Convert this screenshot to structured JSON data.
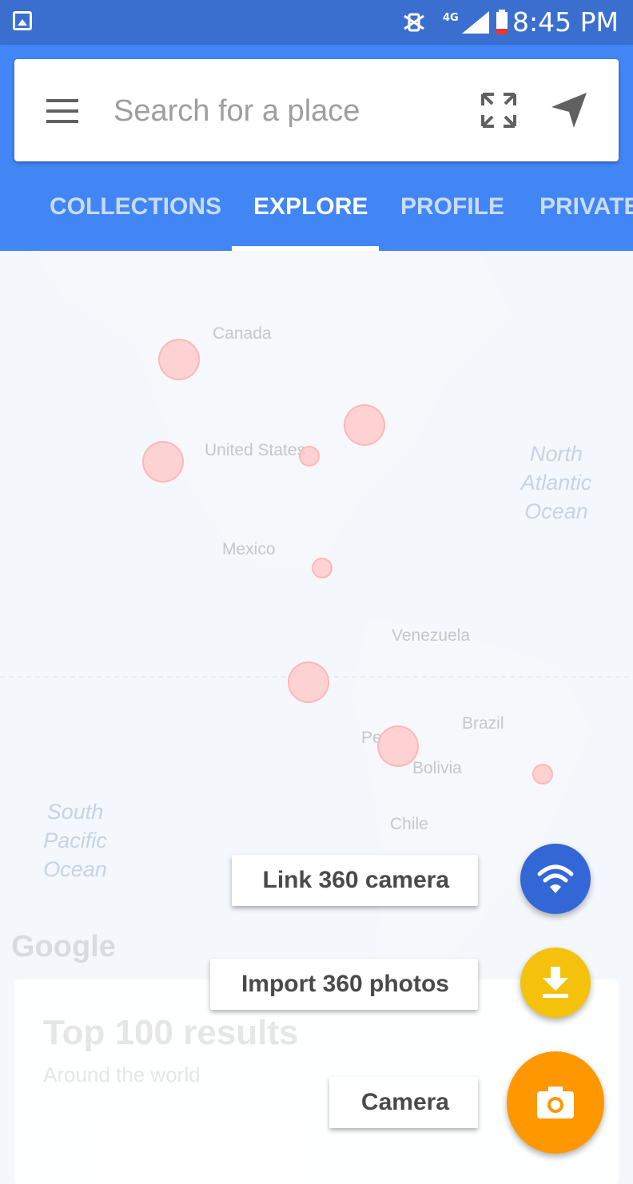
{
  "status_bar": {
    "time": "8:45 PM",
    "network": "4G"
  },
  "search": {
    "placeholder": "Search for a place"
  },
  "tabs": [
    {
      "label": "COLLECTIONS",
      "active": false
    },
    {
      "label": "EXPLORE",
      "active": true
    },
    {
      "label": "PROFILE",
      "active": false
    },
    {
      "label": "PRIVATE",
      "active": false
    }
  ],
  "map": {
    "labels": {
      "canada": "Canada",
      "united_states": "United States",
      "mexico": "Mexico",
      "venezuela": "Venezuela",
      "brazil": "Brazil",
      "peru": "Pe",
      "bolivia": "Bolivia",
      "chile": "Chile"
    },
    "oceans": {
      "north_atlantic": "North\nAtlantic\nOcean",
      "south_pacific": "South\nPacific\nOcean"
    },
    "logo": "Google"
  },
  "card": {
    "title": "Top 100 results",
    "subtitle": "Around the world"
  },
  "fab_menu": {
    "link_camera": "Link 360 camera",
    "import_photos": "Import 360 photos",
    "camera": "Camera"
  },
  "colors": {
    "status_bar": "#3a6fd0",
    "app_bar": "#4285f4",
    "fab_link": "#3367d6",
    "fab_import": "#f4c20d",
    "fab_camera": "#ff9800"
  }
}
